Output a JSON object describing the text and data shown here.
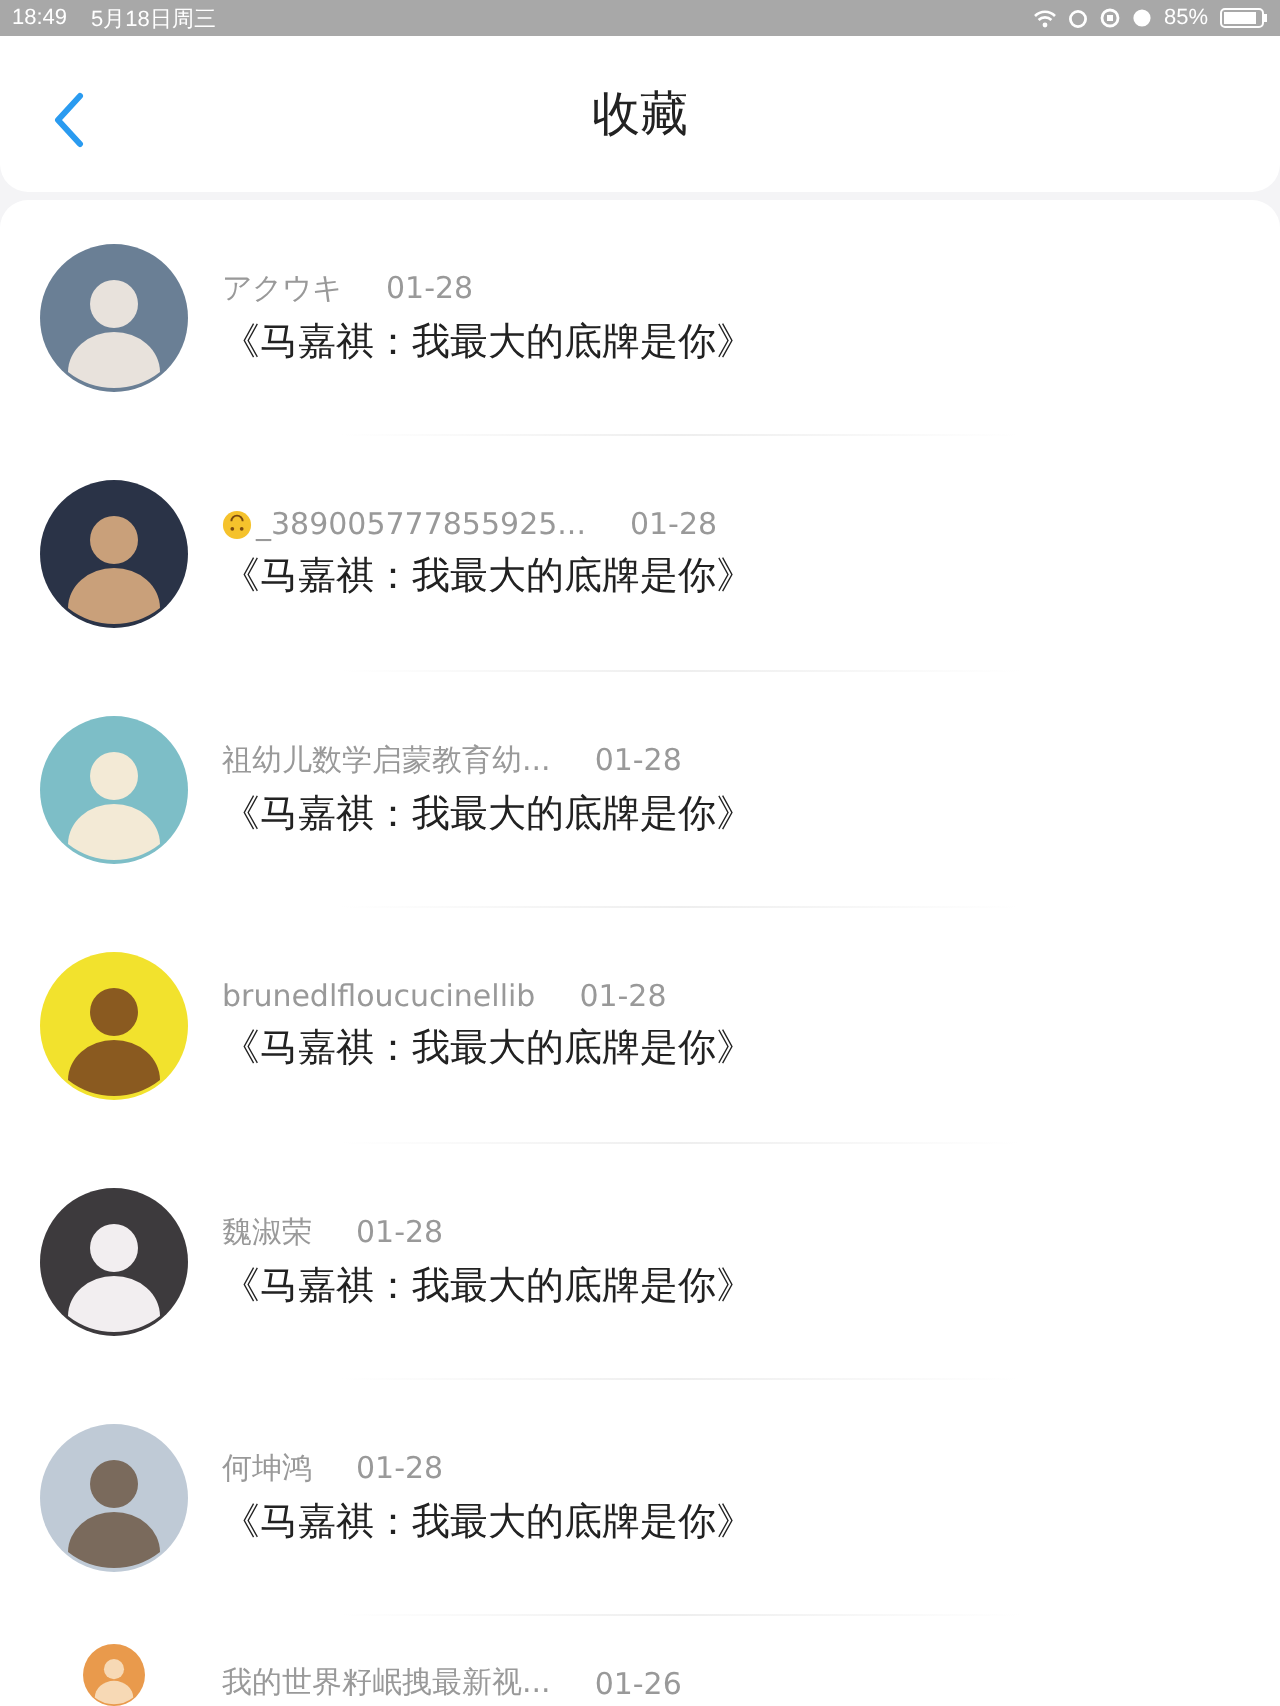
{
  "status_bar": {
    "time": "18:49",
    "date": "5月18日周三",
    "battery": "85%"
  },
  "nav": {
    "title": "收藏"
  },
  "items": [
    {
      "name": "アクウキ",
      "emoji": false,
      "date": "01-28",
      "title": "《马嘉祺：我最大的底牌是你》"
    },
    {
      "name": "_389005777855925...",
      "emoji": true,
      "date": "01-28",
      "title": "《马嘉祺：我最大的底牌是你》"
    },
    {
      "name": "祖幼儿数学启蒙教育幼...",
      "emoji": false,
      "date": "01-28",
      "title": "《马嘉祺：我最大的底牌是你》"
    },
    {
      "name": "brunedlfloucucinellib",
      "emoji": false,
      "date": "01-28",
      "title": "《马嘉祺：我最大的底牌是你》"
    },
    {
      "name": "魏淑荣",
      "emoji": false,
      "date": "01-28",
      "title": "《马嘉祺：我最大的底牌是你》"
    },
    {
      "name": "何坤鸿",
      "emoji": false,
      "date": "01-28",
      "title": "《马嘉祺：我最大的底牌是你》"
    },
    {
      "name": "我的世界籽岷拽最新视...",
      "emoji": false,
      "date": "01-26"
    }
  ]
}
